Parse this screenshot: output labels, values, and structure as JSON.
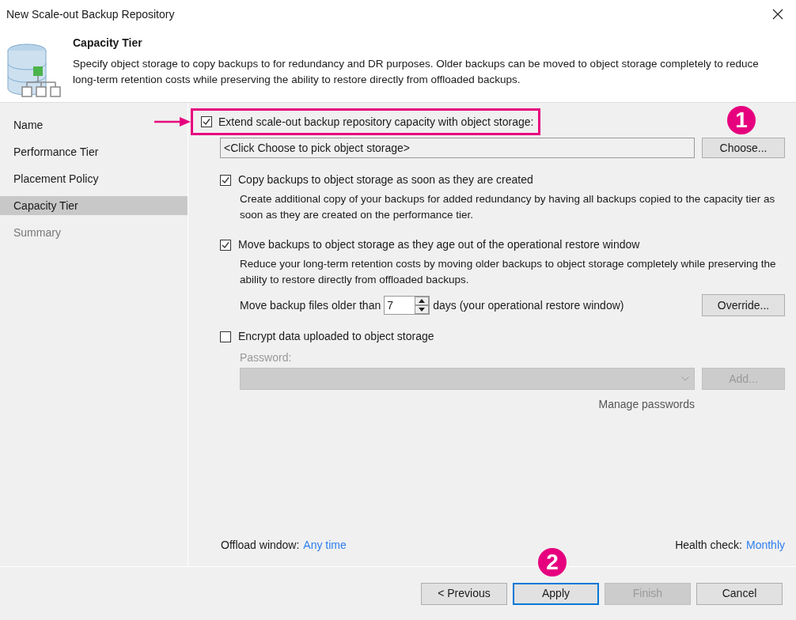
{
  "window": {
    "title": "New Scale-out Backup Repository"
  },
  "header": {
    "title": "Capacity Tier",
    "description": "Specify object storage to copy backups to for redundancy and DR purposes. Older backups can be moved to object storage completely to reduce long-term retention costs while preserving the ability to restore directly from offloaded backups."
  },
  "steps": [
    {
      "label": "Name",
      "selected": false,
      "disabled": false
    },
    {
      "label": "Performance Tier",
      "selected": false,
      "disabled": false
    },
    {
      "label": "Placement Policy",
      "selected": false,
      "disabled": false
    },
    {
      "label": "Capacity Tier",
      "selected": true,
      "disabled": false
    },
    {
      "label": "Summary",
      "selected": false,
      "disabled": true
    }
  ],
  "extend": {
    "label": "Extend scale-out backup repository capacity with object storage:",
    "checked": true,
    "badge": "1"
  },
  "storage_field": {
    "value": "<Click Choose to pick object storage>",
    "button": "Choose..."
  },
  "options": [
    {
      "label": "Copy backups to object storage as soon as they are created",
      "checked": true,
      "description": "Create additional copy of your backups for added redundancy by having all backups copied to the capacity tier as soon as they are created on the performance tier."
    },
    {
      "label": "Move backups to object storage as they age out of the operational restore window",
      "checked": true,
      "description": "Reduce your long-term retention costs by moving older backups to object storage completely while preserving the ability to restore directly from offloaded backups."
    }
  ],
  "move_age": {
    "prefix": "Move backup files older than",
    "value": "7",
    "suffix": "days (your operational restore window)",
    "button": "Override..."
  },
  "encrypt": {
    "label": "Encrypt data uploaded to object storage",
    "checked": false,
    "password_label": "Password:",
    "add_button": "Add...",
    "manage_link": "Manage passwords"
  },
  "footer_links": [
    {
      "label": "Offload window:",
      "value": "Any time"
    },
    {
      "label": "Health check:",
      "value": "Monthly"
    }
  ],
  "buttons": [
    {
      "label": "< Previous",
      "disabled": false,
      "focused": false
    },
    {
      "label": "Apply",
      "disabled": false,
      "focused": true,
      "badge": "2"
    },
    {
      "label": "Finish",
      "disabled": true,
      "focused": false
    },
    {
      "label": "Cancel",
      "disabled": false,
      "focused": false
    }
  ]
}
